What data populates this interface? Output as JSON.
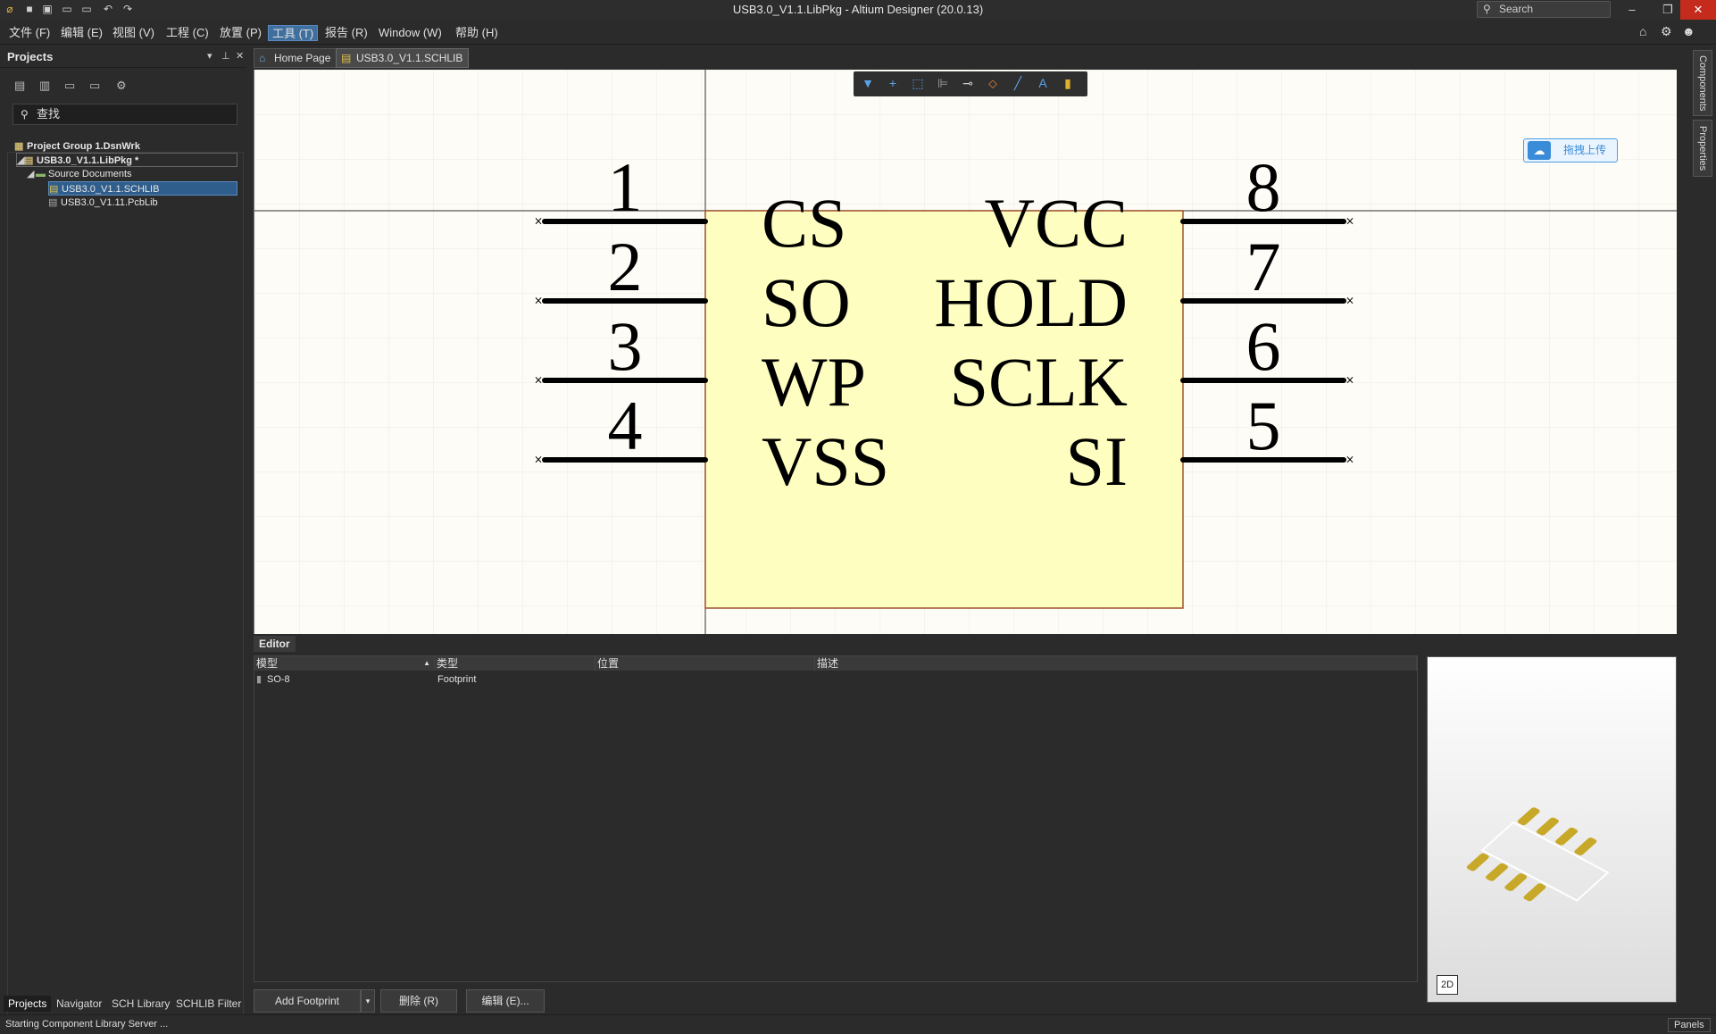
{
  "window": {
    "title": "USB3.0_V1.1.LibPkg - Altium Designer (20.0.13)",
    "search_placeholder": "Search"
  },
  "menu": [
    "文件 (F)",
    "编辑 (E)",
    "视图 (V)",
    "工程 (C)",
    "放置 (P)",
    "工具 (T)",
    "报告 (R)",
    "Window (W)",
    "帮助 (H)"
  ],
  "menu_active": "工具 (T)",
  "projects": {
    "title": "Projects",
    "search_placeholder": "查找",
    "tree": [
      {
        "label": "Project Group 1.DsnWrk",
        "level": 0,
        "icon": "workspace-icon",
        "state": ""
      },
      {
        "label": "USB3.0_V1.1.LibPkg *",
        "level": 1,
        "icon": "libpkg-icon",
        "state": "outlined"
      },
      {
        "label": "Source Documents",
        "level": 2,
        "icon": "folder-icon",
        "state": ""
      },
      {
        "label": "USB3.0_V1.1.SCHLIB",
        "level": 3,
        "icon": "schlib-icon",
        "state": "selected"
      },
      {
        "label": "USB3.0_V1.11.PcbLib",
        "level": 3,
        "icon": "pcblib-icon",
        "state": ""
      }
    ],
    "bottom_tabs": [
      "Projects",
      "Navigator",
      "SCH Library",
      "SCHLIB Filter"
    ]
  },
  "doc_tabs": [
    {
      "label": "Home Page",
      "icon": "home-icon"
    },
    {
      "label": "USB3.0_V1.1.SCHLIB",
      "icon": "schlib-icon",
      "active": true
    }
  ],
  "right_panels": [
    "Components",
    "Properties"
  ],
  "upload_label": "拖拽上传",
  "component": {
    "left_pins": [
      {
        "num": "1",
        "name": "CS"
      },
      {
        "num": "2",
        "name": "SO"
      },
      {
        "num": "3",
        "name": "WP"
      },
      {
        "num": "4",
        "name": "VSS"
      }
    ],
    "right_pins": [
      {
        "num": "8",
        "name": "VCC"
      },
      {
        "num": "7",
        "name": "HOLD"
      },
      {
        "num": "6",
        "name": "SCLK"
      },
      {
        "num": "5",
        "name": "SI"
      }
    ]
  },
  "editor": {
    "label": "Editor",
    "columns": [
      "模型",
      "类型",
      "位置",
      "描述"
    ],
    "rows": [
      {
        "model": "SO-8",
        "type": "Footprint",
        "location": "",
        "description": ""
      }
    ],
    "buttons": {
      "add": "Add Footprint",
      "delete": "删除 (R)",
      "edit": "编辑 (E)..."
    },
    "view_mode": "2D"
  },
  "status": {
    "text": "Starting Component Library Server ...",
    "panels": "Panels"
  },
  "colors": {
    "component_fill": "#fefec0",
    "component_border": "#a0522d",
    "canvas": "#fdfcf6",
    "pad": "#c8a828",
    "accent": "#2f5e8c"
  }
}
